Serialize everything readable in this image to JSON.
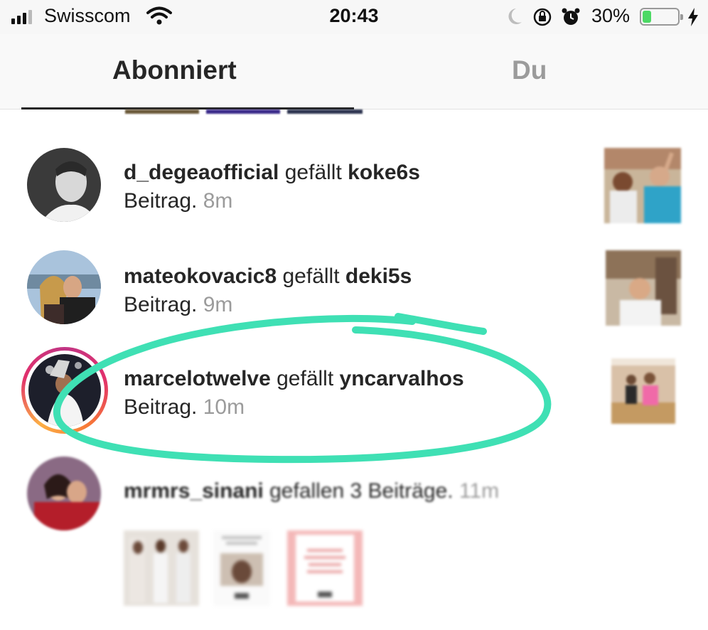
{
  "status_bar": {
    "carrier": "Swisscom",
    "time": "20:43",
    "battery_percent": "30%",
    "battery_level": 0.3,
    "icons": [
      "signal-icon",
      "wifi-icon",
      "moon-icon",
      "rotation-lock-icon",
      "alarm-icon",
      "battery-icon",
      "charging-bolt-icon"
    ]
  },
  "tabs": [
    {
      "label": "Abonniert",
      "active": true
    },
    {
      "label": "Du",
      "active": false
    }
  ],
  "feed": [
    {
      "username": "d_degeaofficial",
      "action": "gefällt",
      "target": "koke6s",
      "type": "Beitrag.",
      "time": "8m"
    },
    {
      "username": "mateokovacic8",
      "action": "gefällt",
      "target": "deki5s",
      "type": "Beitrag.",
      "time": "9m"
    },
    {
      "username": "marcelotwelve",
      "action": "gefällt",
      "target": "yncarvalhos",
      "type": "Beitrag.",
      "time": "10m",
      "highlighted": true
    },
    {
      "username": "mrmrs_sinani",
      "action": "gefallen 3 Beiträge.",
      "time": "11m"
    }
  ],
  "colors": {
    "highlight": "#3fe0b4",
    "accent_text": "#262626",
    "secondary_text": "#9b9b9b",
    "battery": "#4cd964"
  }
}
